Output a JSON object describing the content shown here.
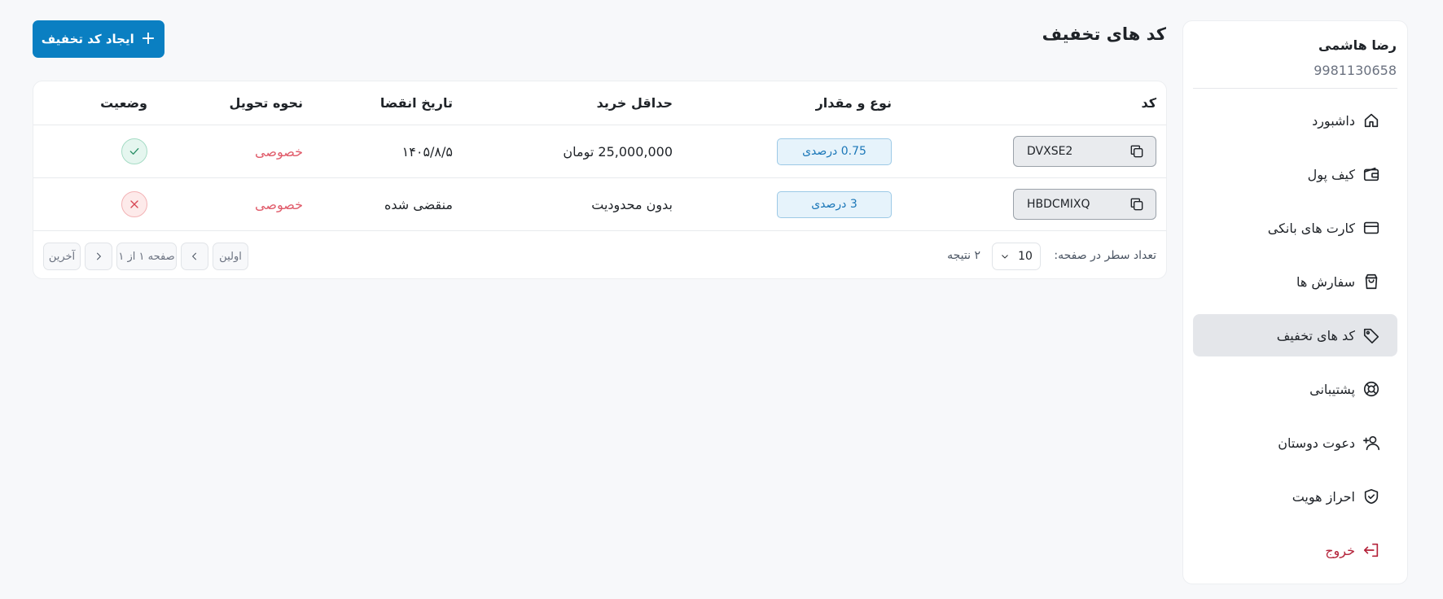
{
  "user": {
    "name": "رضا هاشمی",
    "phone": "9981130658"
  },
  "sidebar": {
    "items": [
      {
        "label": "داشبورد",
        "icon": "home-icon"
      },
      {
        "label": "کیف پول",
        "icon": "wallet-icon"
      },
      {
        "label": "کارت های بانکی",
        "icon": "credit-card-icon"
      },
      {
        "label": "سفارش ها",
        "icon": "shopping-bag-icon"
      },
      {
        "label": "کد های تخفیف",
        "icon": "tag-icon",
        "active": true
      },
      {
        "label": "پشتیبانی",
        "icon": "lifebuoy-icon"
      },
      {
        "label": "دعوت دوستان",
        "icon": "user-plus-icon"
      },
      {
        "label": "احراز هویت",
        "icon": "shield-check-icon"
      }
    ],
    "logout_label": "خروج"
  },
  "header": {
    "title": "کد های تخفیف",
    "create_label": "ایجاد کد تخفیف"
  },
  "table": {
    "columns": [
      "کد",
      "نوع و مقدار",
      "حداقل خرید",
      "تاریخ انقضا",
      "نحوه تحویل",
      "وضعیت"
    ],
    "rows": [
      {
        "code": "DVXSE2",
        "type": "0.75 درصدی",
        "min": "25,000,000 تومان",
        "expiry": "۱۴۰۵/۸/۵",
        "delivery": "خصوصی",
        "status": "active"
      },
      {
        "code": "HBDCMIXQ",
        "type": "3 درصدی",
        "min": "بدون محدودیت",
        "expiry": "منقضی شده",
        "delivery": "خصوصی",
        "status": "expired"
      }
    ]
  },
  "footer": {
    "rows_label": "تعداد سطر در صفحه:",
    "rows_value": "10",
    "results": "۲ نتیجه",
    "first": "اولین",
    "page_info": "صفحه ۱ از ۱",
    "last": "آخرین"
  },
  "colors": {
    "primary": "#0a7fc2",
    "private": "#e05b6a",
    "logout": "#b4233a",
    "success": "#2a8f66",
    "danger": "#d64553"
  }
}
